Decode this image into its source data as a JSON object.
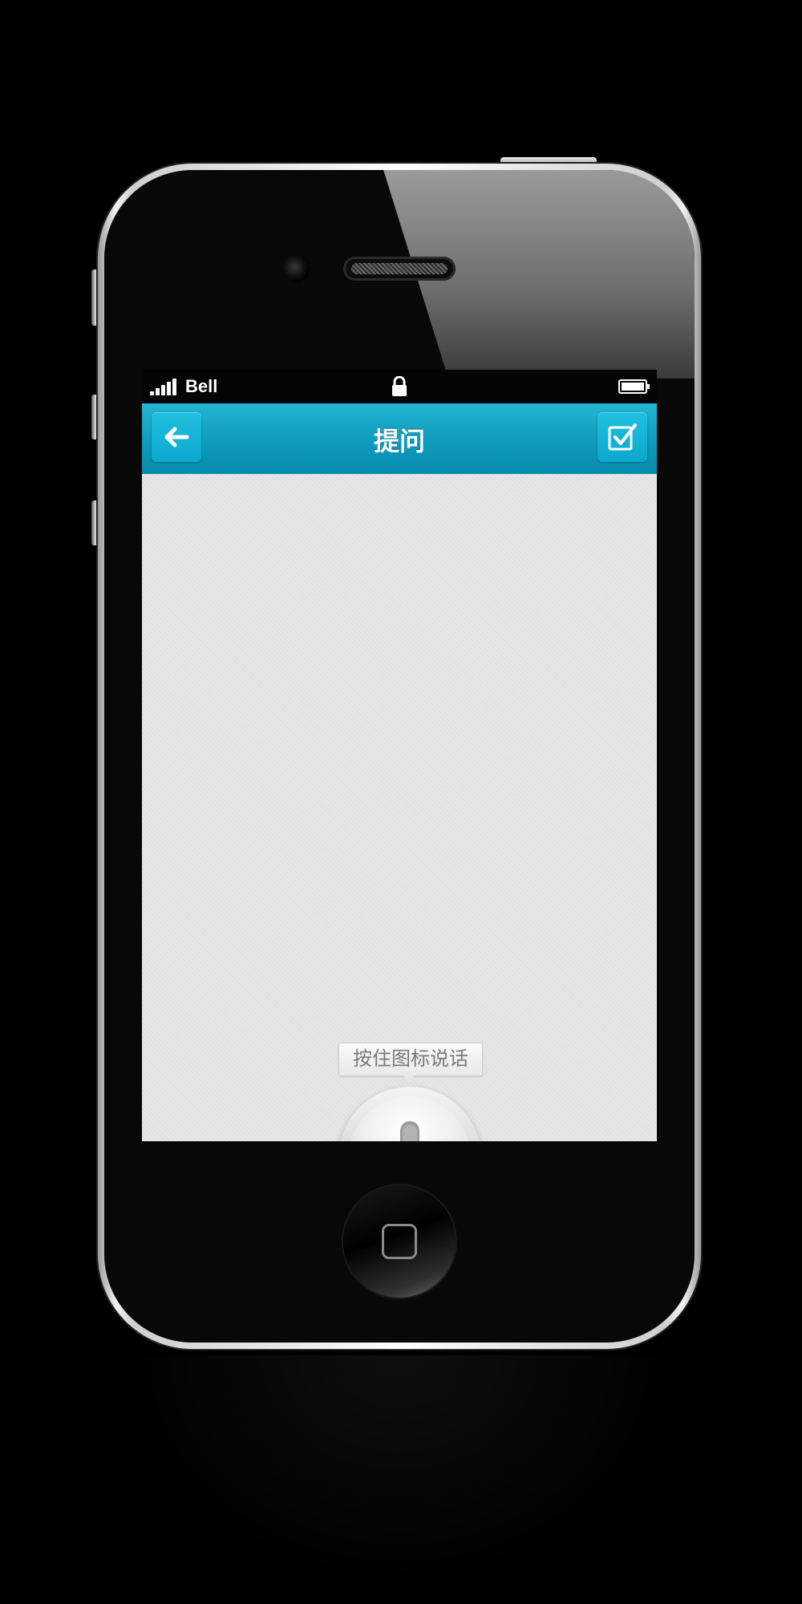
{
  "status_bar": {
    "carrier": "Bell",
    "signal_icon": "signal-bars-icon",
    "lock_icon": "lock-icon",
    "battery_icon": "battery-full-icon"
  },
  "nav": {
    "title": "提问",
    "back_icon": "arrow-left-icon",
    "submit_icon": "checkbox-check-icon",
    "accent_color": "#0e9bbd"
  },
  "voice": {
    "hint": "按住图标说话",
    "mic_icon": "microphone-icon"
  },
  "device": {
    "home_icon": "home-square-icon"
  }
}
